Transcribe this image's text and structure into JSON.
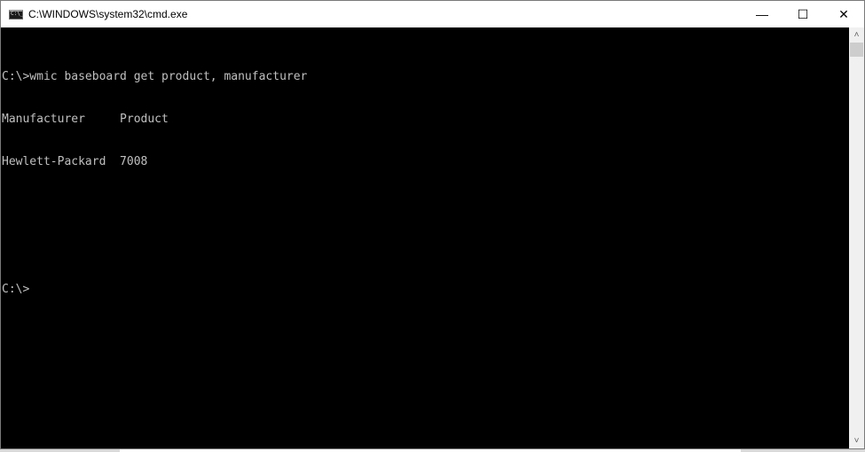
{
  "window": {
    "title": "C:\\WINDOWS\\system32\\cmd.exe",
    "app_icon": "cmd-icon",
    "controls": {
      "minimize": "—",
      "maximize": "☐",
      "close": "✕"
    }
  },
  "console": {
    "lines": [
      "C:\\>wmic baseboard get product, manufacturer",
      "Manufacturer     Product",
      "Hewlett-Packard  7008",
      "",
      "",
      "C:\\>"
    ],
    "foreground": "#c0c0c0",
    "background": "#000000"
  },
  "scrollbar": {
    "up_arrow": "˄",
    "down_arrow": "˅"
  }
}
